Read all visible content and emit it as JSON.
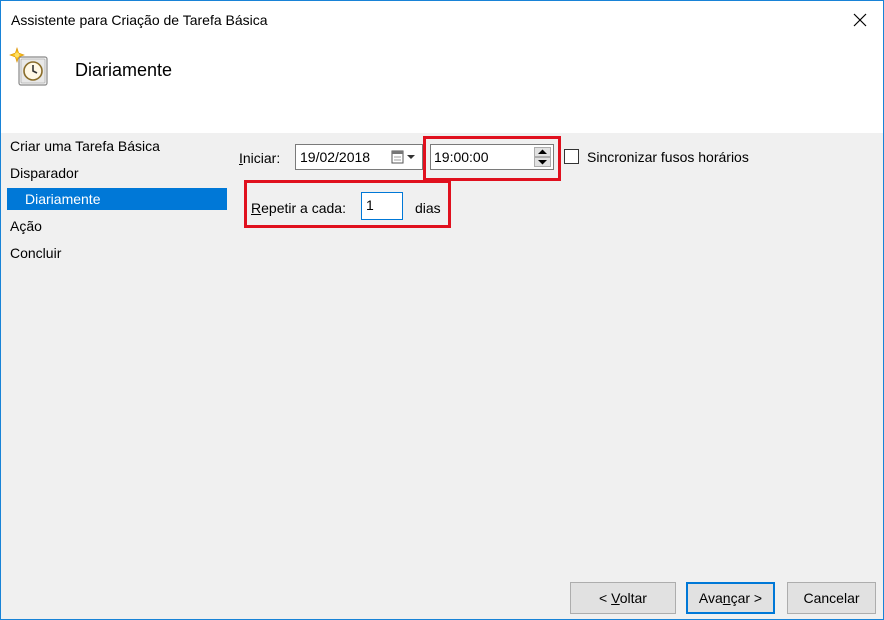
{
  "window": {
    "title": "Assistente para Criação de Tarefa Básica",
    "close_glyph": "✕"
  },
  "header": {
    "title": "Diariamente",
    "icon": "task-scheduler-clock-icon"
  },
  "nav": {
    "items": [
      {
        "label": "Criar uma Tarefa Básica",
        "selected": false,
        "sub": false
      },
      {
        "label": "Disparador",
        "selected": false,
        "sub": false
      },
      {
        "label": "Diariamente",
        "selected": true,
        "sub": true
      },
      {
        "label": "Ação",
        "selected": false,
        "sub": false
      },
      {
        "label": "Concluir",
        "selected": false,
        "sub": false
      }
    ]
  },
  "form": {
    "start_label_underlined": "I",
    "start_label_rest": "niciar:",
    "start_date": "19/02/2018",
    "start_time": "19:00:00",
    "sync_checkbox_label": "Sincronizar fusos horários",
    "sync_checked": false,
    "repeat_label_underlined": "R",
    "repeat_label_rest": "epetir a cada:",
    "repeat_value": "1",
    "repeat_unit": "dias"
  },
  "buttons": {
    "back_pre": "< ",
    "back_underlined": "V",
    "back_post": "oltar",
    "next_pre": "Ava",
    "next_underlined": "n",
    "next_post": "çar >",
    "cancel": "Cancelar"
  },
  "colors": {
    "accent": "#0078d7",
    "highlight_red": "#e0101e",
    "panel_bg": "#f0f0f0"
  }
}
